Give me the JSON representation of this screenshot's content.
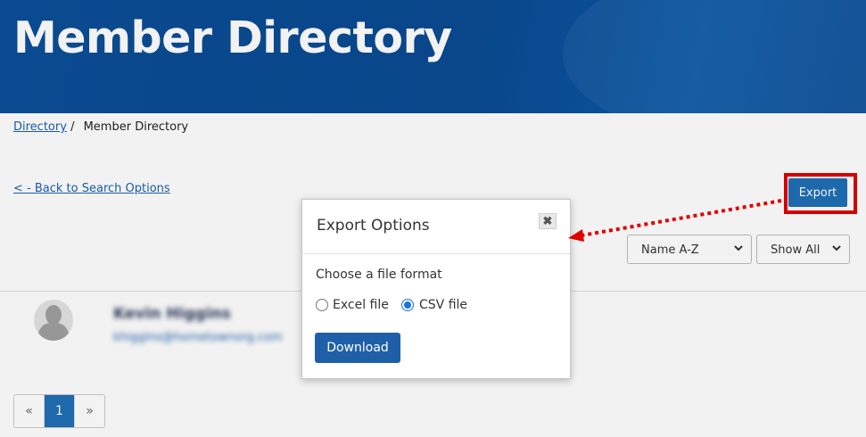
{
  "header": {
    "title": "Member Directory"
  },
  "breadcrumb": {
    "link": "Directory",
    "separator": "/",
    "current": "Member Directory"
  },
  "back_link": "< - Back to Search Options",
  "toolbar": {
    "export_label": "Export",
    "sort_select": {
      "value": "Name A-Z"
    },
    "show_select": {
      "value": "Show All"
    }
  },
  "members": [
    {
      "name": "Kevin Higgins",
      "email": "khiggins@hometownorg.com"
    }
  ],
  "pagination": {
    "prev": "«",
    "current": "1",
    "next": "»"
  },
  "modal": {
    "title": "Export Options",
    "close": "✖",
    "prompt": "Choose a file format",
    "options": [
      {
        "label": "Excel file",
        "checked": false
      },
      {
        "label": "CSV file",
        "checked": true
      }
    ],
    "download_label": "Download"
  },
  "annotation": {
    "highlight_color": "#e00000"
  },
  "colors": {
    "brand": "#0b4e98",
    "primary_button": "#1f6fb5",
    "link": "#1d5fb0"
  }
}
